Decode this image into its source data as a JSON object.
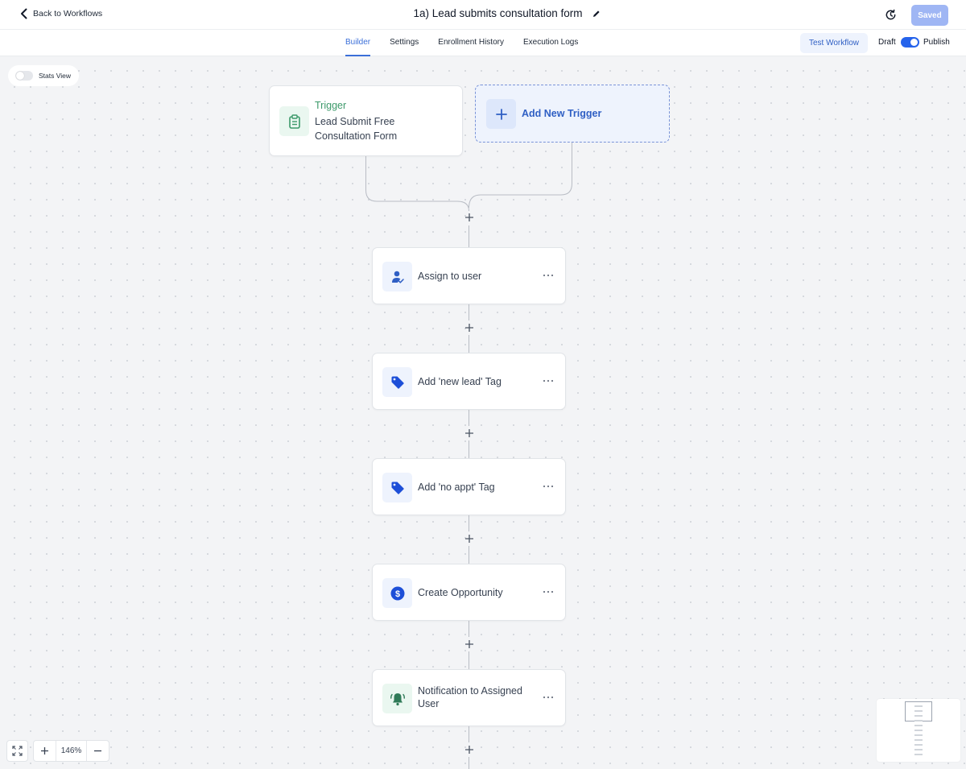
{
  "header": {
    "back_label": "Back to Workflows",
    "title": "1a) Lead submits consultation form",
    "saved_label": "Saved"
  },
  "tabs": [
    {
      "label": "Builder",
      "active": true
    },
    {
      "label": "Settings",
      "active": false
    },
    {
      "label": "Enrollment History",
      "active": false
    },
    {
      "label": "Execution Logs",
      "active": false
    }
  ],
  "toolbar": {
    "test_workflow_label": "Test Workflow",
    "draft_label": "Draft",
    "publish_label": "Publish",
    "publish_enabled": true
  },
  "canvas": {
    "stats_view_label": "Stats View",
    "stats_view_enabled": false,
    "zoom_level": "146%"
  },
  "trigger": {
    "label": "Trigger",
    "name": "Lead Submit Free Consultation Form",
    "icon": "clipboard-icon"
  },
  "add_trigger": {
    "label": "Add New Trigger",
    "icon": "plus-icon"
  },
  "actions": [
    {
      "label": "Assign to user",
      "icon": "user-assign-icon"
    },
    {
      "label": "Add 'new lead' Tag",
      "icon": "tag-icon"
    },
    {
      "label": "Add 'no appt' Tag",
      "icon": "tag-icon"
    },
    {
      "label": "Create Opportunity",
      "icon": "dollar-icon"
    },
    {
      "label": "Notification to Assigned User",
      "icon": "bell-icon"
    }
  ],
  "colors": {
    "accent": "#2563eb",
    "trigger_green": "#3d9a6b",
    "saved_disabled": "#9fb6f4"
  }
}
